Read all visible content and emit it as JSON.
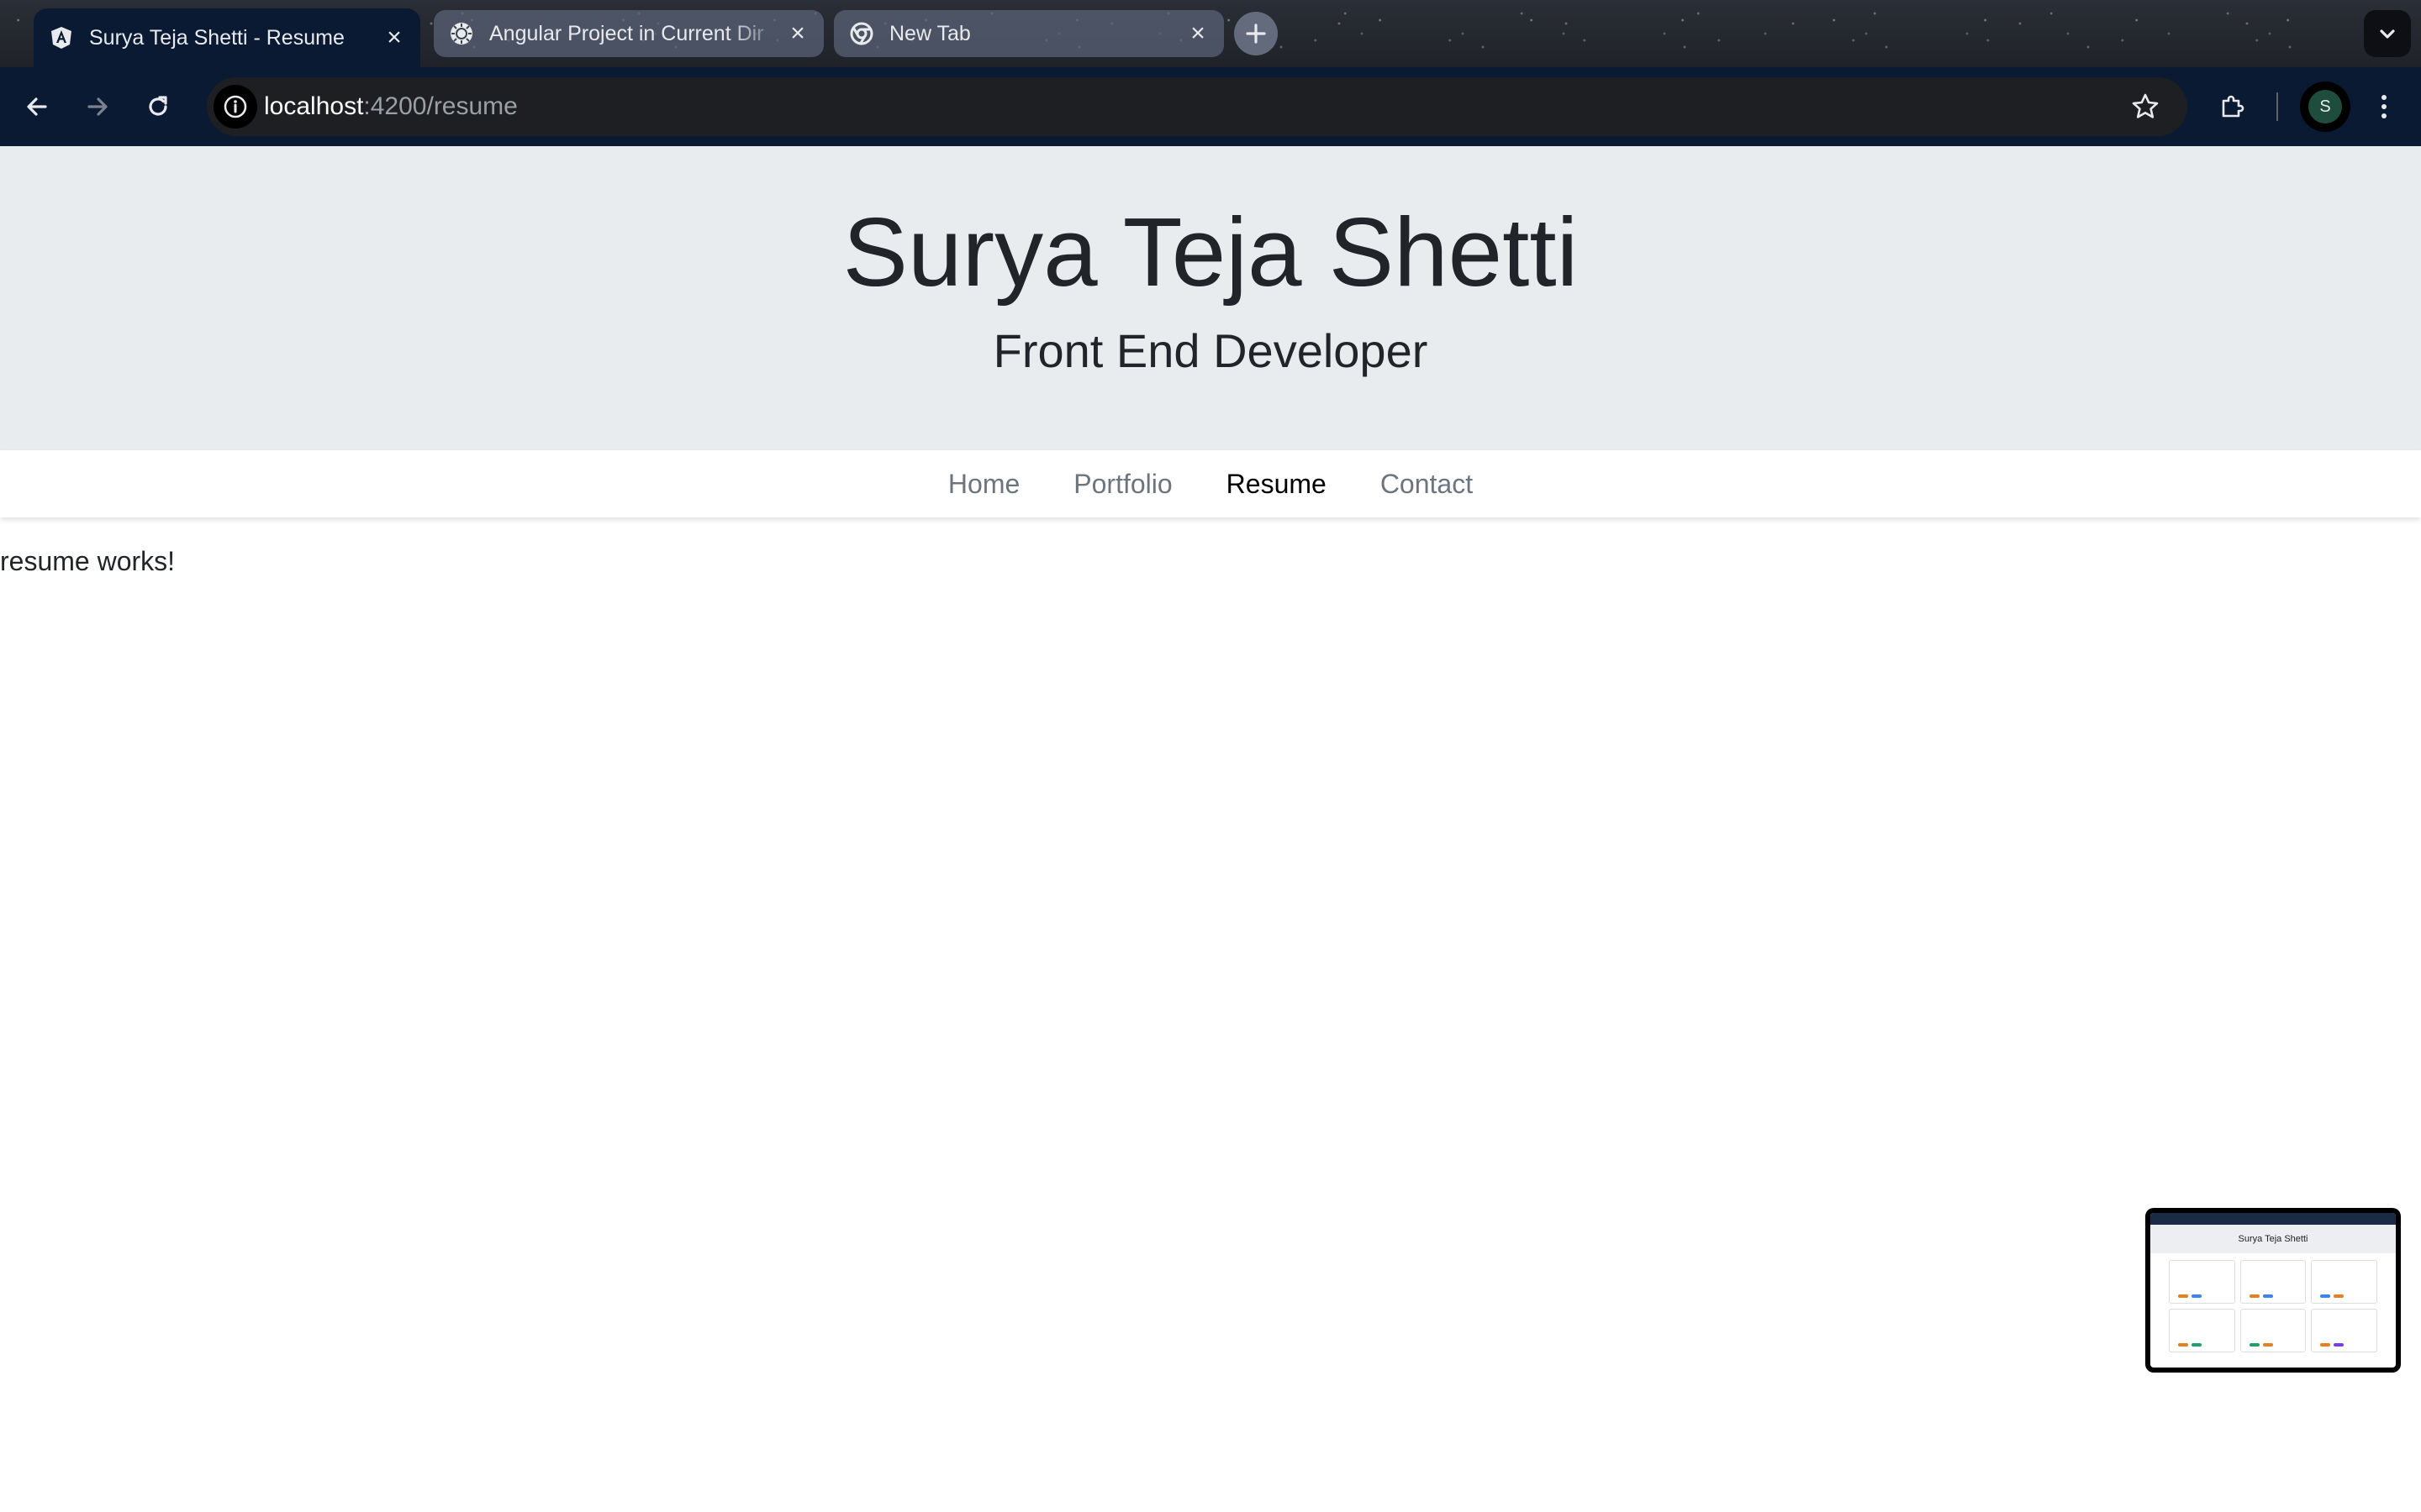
{
  "browser": {
    "tabs": [
      {
        "title": "Surya Teja Shetti - Resume",
        "icon": "angular-icon",
        "active": true
      },
      {
        "title": "Angular Project in Current Dir",
        "icon": "chatgpt-icon",
        "active": false
      },
      {
        "title": "New Tab",
        "icon": "chrome-icon",
        "active": false
      }
    ],
    "address": {
      "host": "localhost",
      "rest": ":4200/resume"
    },
    "profile_initial": "S"
  },
  "page": {
    "hero": {
      "name": "Surya Teja Shetti",
      "role": "Front End Developer"
    },
    "nav": [
      {
        "label": "Home",
        "active": false
      },
      {
        "label": "Portfolio",
        "active": false
      },
      {
        "label": "Resume",
        "active": true
      },
      {
        "label": "Contact",
        "active": false
      }
    ],
    "content_text": "resume works!"
  },
  "preview": {
    "title": "Surya Teja Shetti"
  },
  "colors": {
    "toolbar_bg": "#0b1a33",
    "hero_bg": "#e9ecef",
    "nav_active": "#000000",
    "nav_inactive": "#6c757d"
  }
}
